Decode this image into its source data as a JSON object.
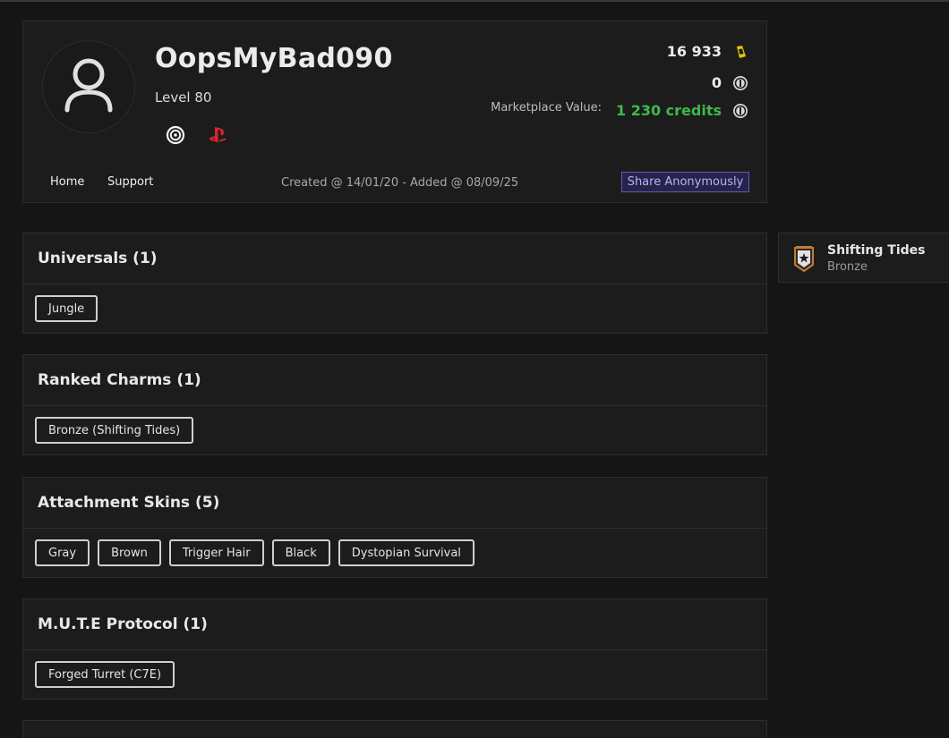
{
  "profile": {
    "username": "OopsMyBad090",
    "level": "Level 80",
    "platforms": [
      "ubisoft-icon",
      "playstation-icon"
    ],
    "renown": "16 933",
    "credits": "0",
    "marketplace_label": "Marketplace Value:",
    "marketplace_value": "1 230 credits",
    "created": "Created @ 14/01/20 - Added @ 08/09/25",
    "accent_green": "#3fb94a",
    "renown_color": "#e6c800"
  },
  "nav": {
    "home": "Home",
    "support": "Support",
    "share": "Share Anonymously"
  },
  "sections": [
    {
      "title": "Universals (1)",
      "items": [
        "Jungle"
      ]
    },
    {
      "title": "Ranked Charms (1)",
      "items": [
        "Bronze (Shifting Tides)"
      ]
    },
    {
      "title": "Attachment Skins (5)",
      "items": [
        "Gray",
        "Brown",
        "Trigger Hair",
        "Black",
        "Dystopian Survival"
      ]
    },
    {
      "title": "M.U.T.E Protocol (1)",
      "items": [
        "Forged Turret (C7E)"
      ]
    }
  ],
  "rank": {
    "season": "Shifting Tides",
    "tier": "Bronze"
  }
}
